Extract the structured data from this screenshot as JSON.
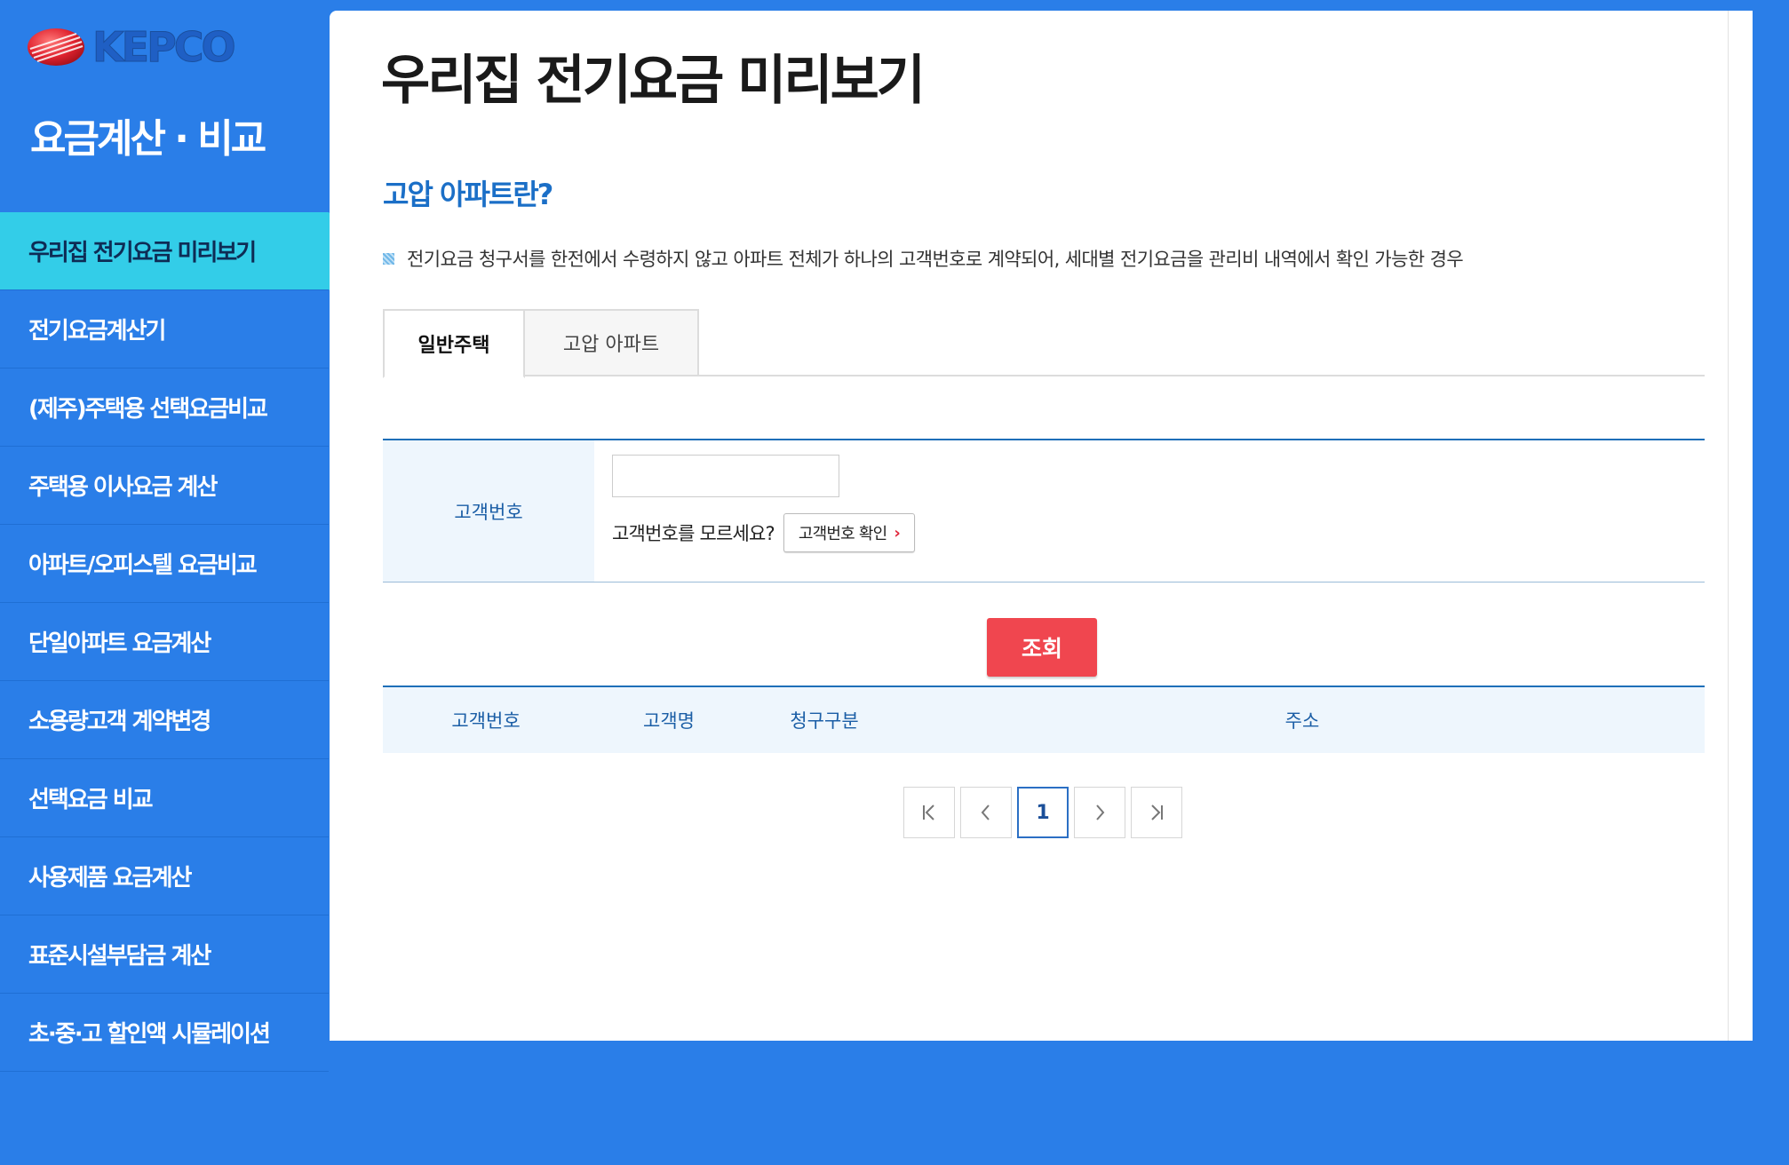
{
  "brand": {
    "logo_text": "KEPCO",
    "section_title": "요금계산 · 비교"
  },
  "sidebar": {
    "items": [
      {
        "label": "우리집 전기요금 미리보기"
      },
      {
        "label": "전기요금계산기"
      },
      {
        "label": "(제주)주택용 선택요금비교"
      },
      {
        "label": "주택용 이사요금 계산"
      },
      {
        "label": "아파트/오피스텔 요금비교"
      },
      {
        "label": "단일아파트 요금계산"
      },
      {
        "label": "소용량고객 계약변경"
      },
      {
        "label": "선택요금 비교"
      },
      {
        "label": "사용제품 요금계산"
      },
      {
        "label": "표준시설부담금 계산"
      },
      {
        "label": "초·중·고 할인액 시뮬레이션"
      }
    ],
    "active_index": 0
  },
  "main": {
    "title": "우리집 전기요금 미리보기",
    "subtitle": "고압 아파트란?",
    "description": "전기요금 청구서를 한전에서 수령하지 않고 아파트 전체가 하나의 고객번호로 계약되어, 세대별 전기요금을 관리비 내역에서 확인 가능한 경우",
    "tabs": [
      {
        "label": "일반주택"
      },
      {
        "label": "고압 아파트"
      }
    ],
    "form": {
      "label": "고객번호",
      "input_value": "",
      "forgot_text": "고객번호를 모르세요?",
      "confirm_button": "고객번호 확인"
    },
    "search_button": "조회",
    "result_columns": [
      "고객번호",
      "고객명",
      "청구구분",
      "주소"
    ],
    "pagination": {
      "current_page": "1"
    }
  },
  "colors": {
    "background": "#2a7ee8",
    "active_menu": "#33cde8",
    "accent_blue": "#1b6fc7",
    "search_button": "#f0464f"
  }
}
